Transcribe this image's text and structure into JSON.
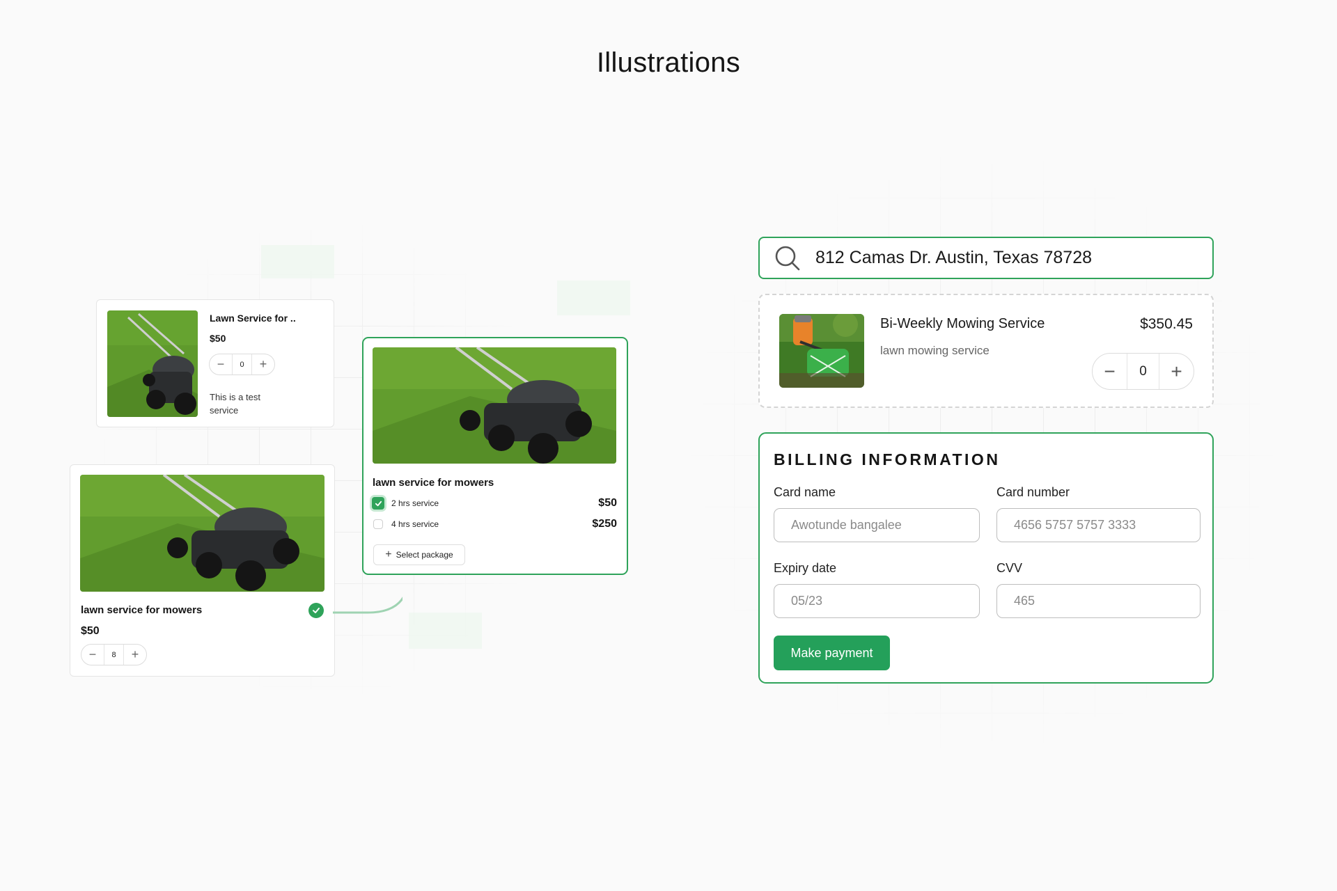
{
  "page": {
    "title": "Illustrations"
  },
  "colors": {
    "accent": "#2fa35a",
    "button": "#24a05a",
    "background": "#fafafa"
  },
  "card_small": {
    "title": "Lawn Service for ..",
    "price": "$50",
    "quantity": "0",
    "description": "This is a test service",
    "minus_symbol": "−",
    "plus_symbol": "+"
  },
  "card_large": {
    "title": "lawn service for mowers",
    "price": "$50",
    "quantity": "8",
    "selected_icon": "check-circle-icon",
    "minus_symbol": "−",
    "plus_symbol": "+"
  },
  "card_packages": {
    "title": "lawn service for mowers",
    "options": [
      {
        "label": "2 hrs service",
        "price": "$50",
        "checked": true
      },
      {
        "label": "4 hrs service",
        "price": "$250",
        "checked": false
      }
    ],
    "select_label": "Select package",
    "select_icon": "plus-icon"
  },
  "search": {
    "icon": "search-icon",
    "value": "812 Camas Dr. Austin, Texas 78728"
  },
  "service": {
    "title": "Bi-Weekly Mowing Service",
    "subtitle": "lawn mowing service",
    "price": "$350.45",
    "quantity": "0",
    "minus_symbol": "−",
    "plus_symbol": "+"
  },
  "billing": {
    "title": "BILLING INFORMATION",
    "card_name": {
      "label": "Card name",
      "placeholder": "Awotunde bangalee"
    },
    "card_number": {
      "label": "Card number",
      "placeholder": "4656 5757 5757 3333"
    },
    "expiry": {
      "label": "Expiry date",
      "placeholder": "05/23"
    },
    "cvv": {
      "label": "CVV",
      "placeholder": "465"
    },
    "submit_label": "Make payment"
  }
}
